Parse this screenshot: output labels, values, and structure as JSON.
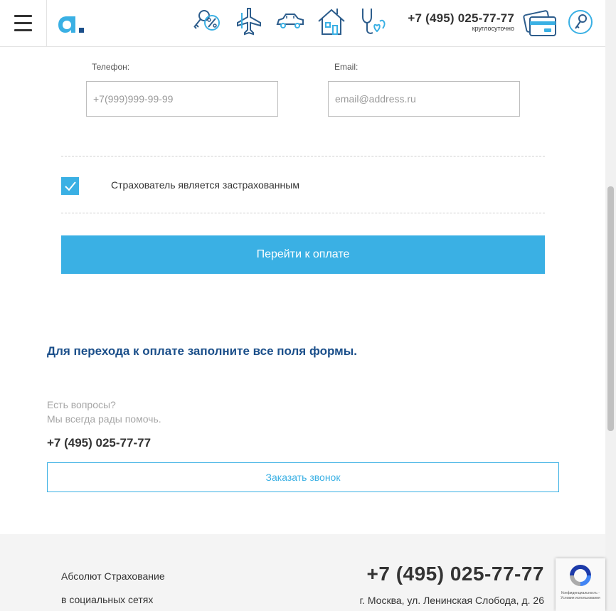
{
  "header": {
    "nav_icons": [
      "key-percent-icon",
      "airplane-icon",
      "car-icon",
      "house-icon",
      "stethoscope-heart-icon"
    ],
    "phone": "+7 (495) 025-77-77",
    "phone_note": "круглосуточно"
  },
  "form": {
    "phone_label": "Телефон:",
    "phone_placeholder": "+7(999)999-99-99",
    "email_label": "Email:",
    "email_placeholder": "email@address.ru",
    "checkbox_label": "Страхователь является застрахованным",
    "checkbox_checked": true,
    "pay_button": "Перейти к оплате"
  },
  "hint": "Для перехода к оплате заполните все поля формы.",
  "help": {
    "line1": "Есть вопросы?",
    "line2": "Мы всегда рады помочь.",
    "phone": "+7 (495) 025-77-77",
    "call_button": "Заказать звонок"
  },
  "footer": {
    "company": "Абсолют Страхование",
    "social": "в социальных сетях",
    "phone": "+7 (495) 025-77-77",
    "address": "г. Москва, ул. Ленинская Слобода, д. 26"
  },
  "recaptcha": {
    "text": "Конфиденциальность - Условия использования"
  },
  "colors": {
    "accent": "#3ab0e4",
    "hint": "#1b4f8a",
    "icon_dark": "#2d5d8c"
  }
}
